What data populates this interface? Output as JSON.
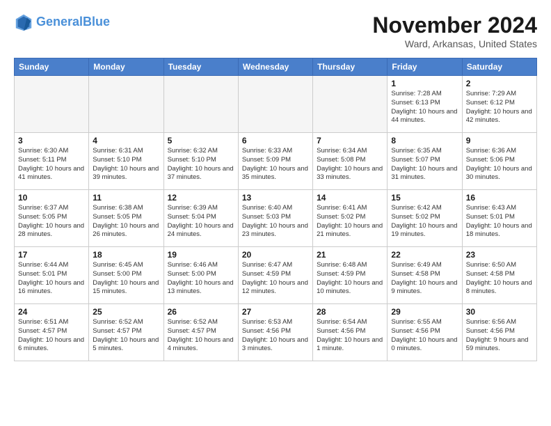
{
  "header": {
    "logo_general": "General",
    "logo_blue": "Blue",
    "month": "November 2024",
    "location": "Ward, Arkansas, United States"
  },
  "weekdays": [
    "Sunday",
    "Monday",
    "Tuesday",
    "Wednesday",
    "Thursday",
    "Friday",
    "Saturday"
  ],
  "weeks": [
    [
      {
        "day": "",
        "empty": true
      },
      {
        "day": "",
        "empty": true
      },
      {
        "day": "",
        "empty": true
      },
      {
        "day": "",
        "empty": true
      },
      {
        "day": "",
        "empty": true
      },
      {
        "day": "1",
        "sunrise": "Sunrise: 7:28 AM",
        "sunset": "Sunset: 6:13 PM",
        "daylight": "Daylight: 10 hours and 44 minutes."
      },
      {
        "day": "2",
        "sunrise": "Sunrise: 7:29 AM",
        "sunset": "Sunset: 6:12 PM",
        "daylight": "Daylight: 10 hours and 42 minutes."
      }
    ],
    [
      {
        "day": "3",
        "sunrise": "Sunrise: 6:30 AM",
        "sunset": "Sunset: 5:11 PM",
        "daylight": "Daylight: 10 hours and 41 minutes."
      },
      {
        "day": "4",
        "sunrise": "Sunrise: 6:31 AM",
        "sunset": "Sunset: 5:10 PM",
        "daylight": "Daylight: 10 hours and 39 minutes."
      },
      {
        "day": "5",
        "sunrise": "Sunrise: 6:32 AM",
        "sunset": "Sunset: 5:10 PM",
        "daylight": "Daylight: 10 hours and 37 minutes."
      },
      {
        "day": "6",
        "sunrise": "Sunrise: 6:33 AM",
        "sunset": "Sunset: 5:09 PM",
        "daylight": "Daylight: 10 hours and 35 minutes."
      },
      {
        "day": "7",
        "sunrise": "Sunrise: 6:34 AM",
        "sunset": "Sunset: 5:08 PM",
        "daylight": "Daylight: 10 hours and 33 minutes."
      },
      {
        "day": "8",
        "sunrise": "Sunrise: 6:35 AM",
        "sunset": "Sunset: 5:07 PM",
        "daylight": "Daylight: 10 hours and 31 minutes."
      },
      {
        "day": "9",
        "sunrise": "Sunrise: 6:36 AM",
        "sunset": "Sunset: 5:06 PM",
        "daylight": "Daylight: 10 hours and 30 minutes."
      }
    ],
    [
      {
        "day": "10",
        "sunrise": "Sunrise: 6:37 AM",
        "sunset": "Sunset: 5:05 PM",
        "daylight": "Daylight: 10 hours and 28 minutes."
      },
      {
        "day": "11",
        "sunrise": "Sunrise: 6:38 AM",
        "sunset": "Sunset: 5:05 PM",
        "daylight": "Daylight: 10 hours and 26 minutes."
      },
      {
        "day": "12",
        "sunrise": "Sunrise: 6:39 AM",
        "sunset": "Sunset: 5:04 PM",
        "daylight": "Daylight: 10 hours and 24 minutes."
      },
      {
        "day": "13",
        "sunrise": "Sunrise: 6:40 AM",
        "sunset": "Sunset: 5:03 PM",
        "daylight": "Daylight: 10 hours and 23 minutes."
      },
      {
        "day": "14",
        "sunrise": "Sunrise: 6:41 AM",
        "sunset": "Sunset: 5:02 PM",
        "daylight": "Daylight: 10 hours and 21 minutes."
      },
      {
        "day": "15",
        "sunrise": "Sunrise: 6:42 AM",
        "sunset": "Sunset: 5:02 PM",
        "daylight": "Daylight: 10 hours and 19 minutes."
      },
      {
        "day": "16",
        "sunrise": "Sunrise: 6:43 AM",
        "sunset": "Sunset: 5:01 PM",
        "daylight": "Daylight: 10 hours and 18 minutes."
      }
    ],
    [
      {
        "day": "17",
        "sunrise": "Sunrise: 6:44 AM",
        "sunset": "Sunset: 5:01 PM",
        "daylight": "Daylight: 10 hours and 16 minutes."
      },
      {
        "day": "18",
        "sunrise": "Sunrise: 6:45 AM",
        "sunset": "Sunset: 5:00 PM",
        "daylight": "Daylight: 10 hours and 15 minutes."
      },
      {
        "day": "19",
        "sunrise": "Sunrise: 6:46 AM",
        "sunset": "Sunset: 5:00 PM",
        "daylight": "Daylight: 10 hours and 13 minutes."
      },
      {
        "day": "20",
        "sunrise": "Sunrise: 6:47 AM",
        "sunset": "Sunset: 4:59 PM",
        "daylight": "Daylight: 10 hours and 12 minutes."
      },
      {
        "day": "21",
        "sunrise": "Sunrise: 6:48 AM",
        "sunset": "Sunset: 4:59 PM",
        "daylight": "Daylight: 10 hours and 10 minutes."
      },
      {
        "day": "22",
        "sunrise": "Sunrise: 6:49 AM",
        "sunset": "Sunset: 4:58 PM",
        "daylight": "Daylight: 10 hours and 9 minutes."
      },
      {
        "day": "23",
        "sunrise": "Sunrise: 6:50 AM",
        "sunset": "Sunset: 4:58 PM",
        "daylight": "Daylight: 10 hours and 8 minutes."
      }
    ],
    [
      {
        "day": "24",
        "sunrise": "Sunrise: 6:51 AM",
        "sunset": "Sunset: 4:57 PM",
        "daylight": "Daylight: 10 hours and 6 minutes."
      },
      {
        "day": "25",
        "sunrise": "Sunrise: 6:52 AM",
        "sunset": "Sunset: 4:57 PM",
        "daylight": "Daylight: 10 hours and 5 minutes."
      },
      {
        "day": "26",
        "sunrise": "Sunrise: 6:52 AM",
        "sunset": "Sunset: 4:57 PM",
        "daylight": "Daylight: 10 hours and 4 minutes."
      },
      {
        "day": "27",
        "sunrise": "Sunrise: 6:53 AM",
        "sunset": "Sunset: 4:56 PM",
        "daylight": "Daylight: 10 hours and 3 minutes."
      },
      {
        "day": "28",
        "sunrise": "Sunrise: 6:54 AM",
        "sunset": "Sunset: 4:56 PM",
        "daylight": "Daylight: 10 hours and 1 minute."
      },
      {
        "day": "29",
        "sunrise": "Sunrise: 6:55 AM",
        "sunset": "Sunset: 4:56 PM",
        "daylight": "Daylight: 10 hours and 0 minutes."
      },
      {
        "day": "30",
        "sunrise": "Sunrise: 6:56 AM",
        "sunset": "Sunset: 4:56 PM",
        "daylight": "Daylight: 9 hours and 59 minutes."
      }
    ]
  ]
}
